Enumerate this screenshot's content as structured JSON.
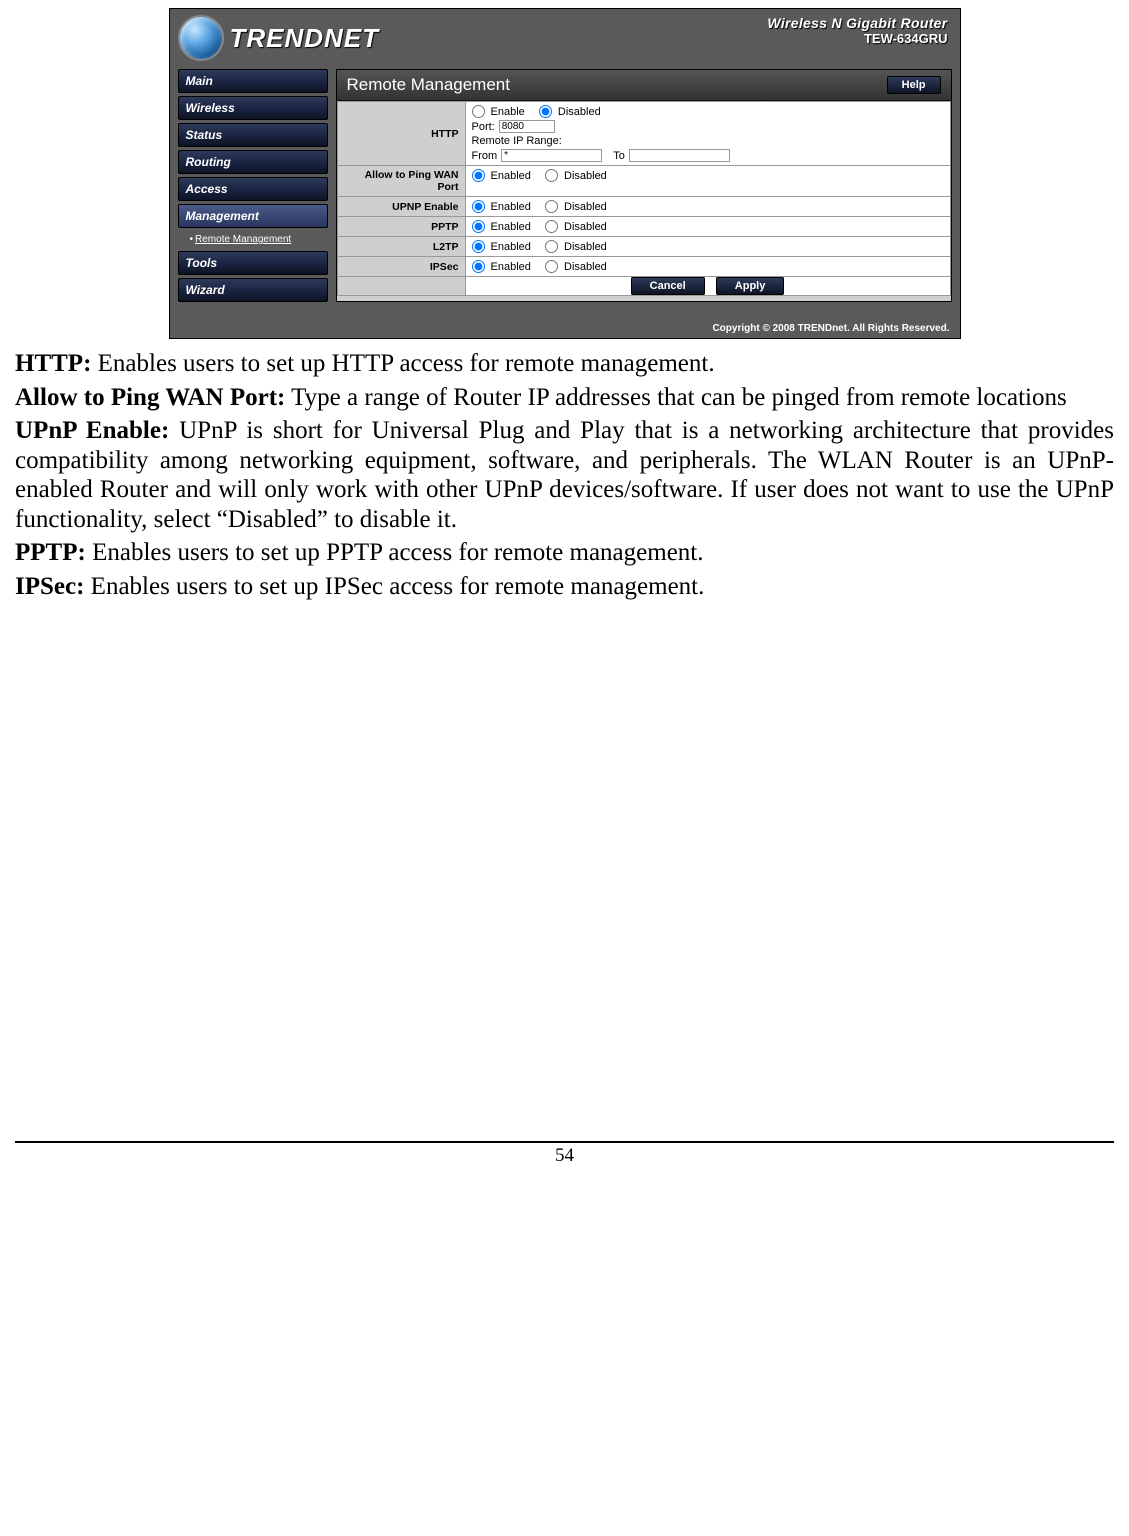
{
  "router": {
    "brand": "TRENDNET",
    "model_title": "Wireless N Gigabit Router",
    "model_sub": "TEW-634GRU",
    "nav": {
      "items": [
        {
          "label": "Main"
        },
        {
          "label": "Wireless"
        },
        {
          "label": "Status"
        },
        {
          "label": "Routing"
        },
        {
          "label": "Access"
        },
        {
          "label": "Management",
          "active": true
        },
        {
          "label": "Tools"
        },
        {
          "label": "Wizard"
        }
      ],
      "subitem": "Remote Management"
    },
    "panel_title": "Remote Management",
    "help": "Help",
    "rows": {
      "http": {
        "label": "HTTP",
        "enable": "Enable",
        "disabled": "Disabled",
        "port_label": "Port:",
        "port_value": "8080",
        "range_label": "Remote IP Range:",
        "from_label": "From",
        "from_value": "*",
        "to_label": "To",
        "to_value": ""
      },
      "ping": {
        "label": "Allow to Ping WAN Port",
        "enabled": "Enabled",
        "disabled": "Disabled"
      },
      "upnp": {
        "label": "UPNP Enable",
        "enabled": "Enabled",
        "disabled": "Disabled"
      },
      "pptp": {
        "label": "PPTP",
        "enabled": "Enabled",
        "disabled": "Disabled"
      },
      "l2tp": {
        "label": "L2TP",
        "enabled": "Enabled",
        "disabled": "Disabled"
      },
      "ipsec": {
        "label": "IPSec",
        "enabled": "Enabled",
        "disabled": "Disabled"
      }
    },
    "cancel": "Cancel",
    "apply": "Apply",
    "copyright": "Copyright © 2008 TRENDnet. All Rights Reserved."
  },
  "doc": {
    "http_b": "HTTP:",
    "http_t": " Enables users to set up HTTP access for remote management.",
    "ping_b": "Allow to Ping WAN Port:",
    "ping_t": " Type a range of Router IP addresses that can be pinged from remote locations",
    "upnp_b": "UPnP Enable:",
    "upnp_t": " UPnP is short for Universal Plug and Play that is a networking architecture that provides compatibility among networking equipment, software, and peripherals. The WLAN Router is an UPnP-enabled Router and will only work with other UPnP devices/software. If user does not want to use the UPnP functionality, select “Disabled” to disable it.",
    "pptp_b": "PPTP:",
    "pptp_t": " Enables users to set up PPTP access for remote management.",
    "ipsec_b": "IPSec:",
    "ipsec_t": " Enables users to set up IPSec access for remote management."
  },
  "page_number": "54"
}
